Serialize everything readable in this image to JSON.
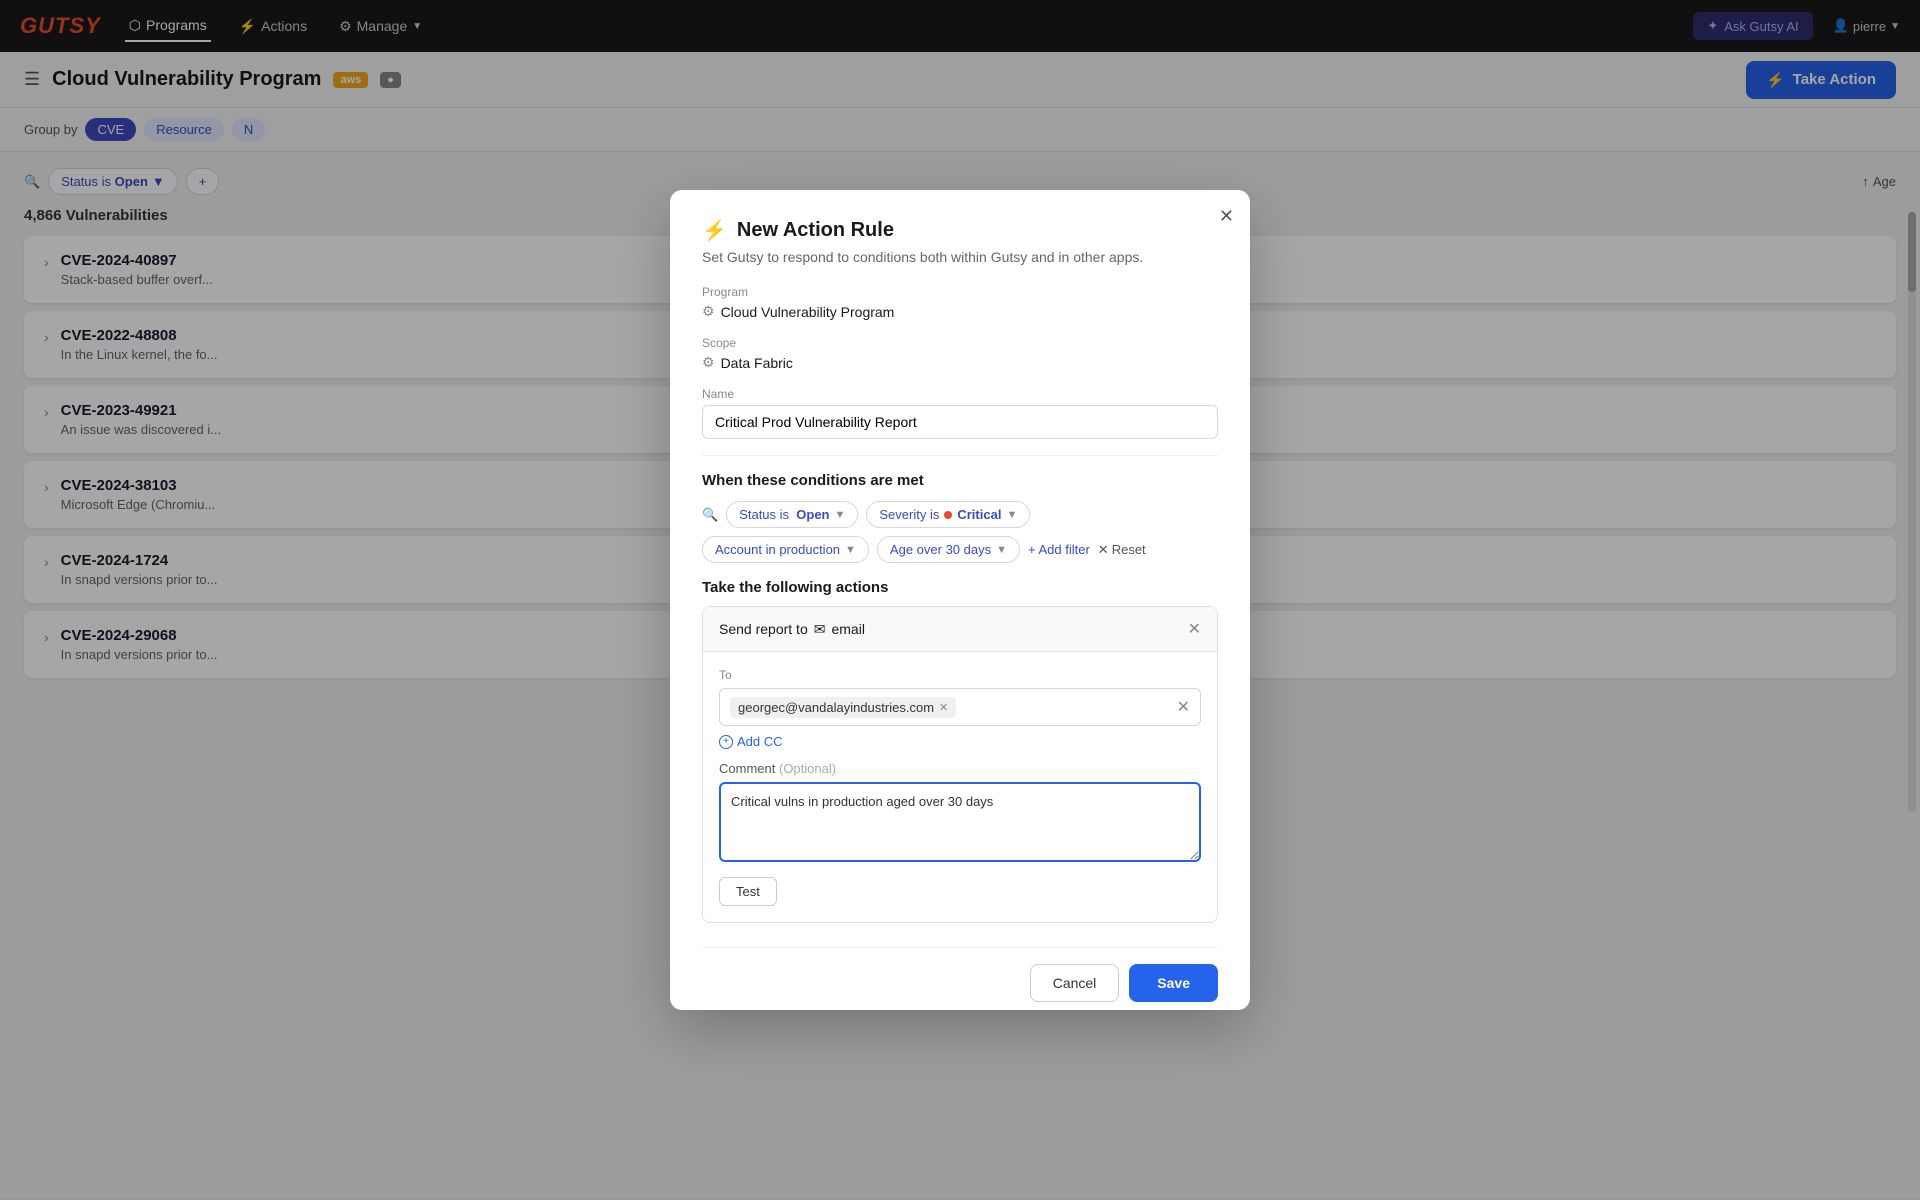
{
  "app": {
    "logo": "GUTSY"
  },
  "topnav": {
    "items": [
      {
        "id": "programs",
        "label": "Programs",
        "active": true
      },
      {
        "id": "actions",
        "label": "Actions",
        "active": false
      },
      {
        "id": "manage",
        "label": "Manage",
        "active": false,
        "hasDropdown": true
      }
    ],
    "askAI": "Ask Gutsy AI",
    "user": "pierre"
  },
  "secHeader": {
    "title": "Cloud Vulnerability Program",
    "badge1": "aws",
    "takeActionLabel": "Take Action"
  },
  "filterBar": {
    "groupByLabel": "Group by",
    "chips": [
      "CVE",
      "Resource",
      "N"
    ],
    "sortLabel": "Age"
  },
  "content": {
    "vulnCount": "4,866 Vulnerabilities",
    "filters": [
      {
        "label": "Status is  Open"
      },
      {
        "label": "+ "
      }
    ],
    "sortLabel": "Age",
    "cves": [
      {
        "id": "CVE-2024-40897",
        "desc": "Stack-based buffer overf..."
      },
      {
        "id": "CVE-2022-48808",
        "desc": "In the Linux kernel, the fo..."
      },
      {
        "id": "CVE-2023-49921",
        "desc": "An issue was discovered i..."
      },
      {
        "id": "CVE-2024-38103",
        "desc": "Microsoft Edge (Chromiu..."
      },
      {
        "id": "CVE-2024-1724",
        "desc": "In snapd versions prior to..."
      },
      {
        "id": "CVE-2024-29068",
        "desc": "In snapd versions prior to..."
      }
    ]
  },
  "modal": {
    "title": "New Action Rule",
    "subtitle": "Set Gutsy to respond to conditions both within Gutsy and in other apps.",
    "programLabel": "Program",
    "programValue": "Cloud Vulnerability Program",
    "scopeLabel": "Scope",
    "scopeValue": "Data Fabric",
    "nameLabel": "Name",
    "nameValue": "Critical Prod Vulnerability Report",
    "conditionsLabel": "When these conditions are met",
    "conditions": [
      {
        "id": "status",
        "label": "Status is",
        "value": "Open"
      },
      {
        "id": "severity",
        "label": "Severity is",
        "value": "Critical",
        "hasDot": true
      },
      {
        "id": "account",
        "label": "Account in production"
      },
      {
        "id": "age",
        "label": "Age over 30 days"
      }
    ],
    "addFilterLabel": "+ Add filter",
    "resetLabel": "Reset",
    "actionsLabel": "Take the following actions",
    "actionCard": {
      "title": "Send report to",
      "emailIcon": "✉",
      "emailType": "email",
      "toLabel": "To",
      "emailAddress": "georgec@vandalayindustries.com",
      "addCCLabel": "Add CC",
      "commentLabel": "Comment",
      "commentOptional": "(Optional)",
      "commentValue": "Critical vulns in production aged over 30 days",
      "testLabel": "Test"
    },
    "cancelLabel": "Cancel",
    "saveLabel": "Save"
  }
}
